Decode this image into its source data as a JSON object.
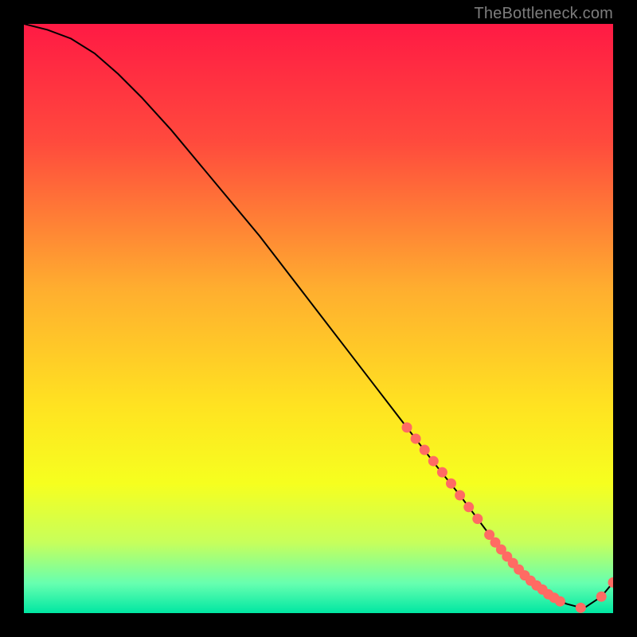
{
  "attribution": "TheBottleneck.com",
  "chart_data": {
    "type": "line",
    "title": "",
    "xlabel": "",
    "ylabel": "",
    "xlim": [
      0,
      100
    ],
    "ylim": [
      0,
      100
    ],
    "gradient_stops": [
      {
        "offset": 0,
        "color": "#ff1a44"
      },
      {
        "offset": 20,
        "color": "#ff4a3d"
      },
      {
        "offset": 45,
        "color": "#ffae2f"
      },
      {
        "offset": 65,
        "color": "#ffe321"
      },
      {
        "offset": 78,
        "color": "#f6ff1f"
      },
      {
        "offset": 88,
        "color": "#c7ff5b"
      },
      {
        "offset": 95,
        "color": "#66ffb0"
      },
      {
        "offset": 100,
        "color": "#00e7a2"
      }
    ],
    "series": [
      {
        "name": "bottleneck-curve",
        "type": "line",
        "color": "#000000",
        "x": [
          0,
          4,
          8,
          12,
          16,
          20,
          25,
          30,
          35,
          40,
          45,
          50,
          55,
          60,
          65,
          70,
          74,
          77,
          80,
          83,
          86,
          89,
          92,
          95,
          98,
          100
        ],
        "values": [
          100,
          99,
          97.5,
          95,
          91.5,
          87.5,
          82,
          76,
          70,
          64,
          57.5,
          51,
          44.5,
          38,
          31.5,
          25,
          20,
          16,
          12,
          8.5,
          5.5,
          3.2,
          1.6,
          0.8,
          2.8,
          5.2
        ]
      },
      {
        "name": "highlight-points",
        "type": "scatter",
        "color": "#ff6b63",
        "x": [
          65,
          66.5,
          68,
          69.5,
          71,
          72.5,
          74,
          75.5,
          77,
          79,
          80,
          81,
          82,
          83,
          84,
          85,
          86,
          87,
          88,
          89,
          90,
          91,
          94.5,
          98,
          100
        ],
        "values": [
          31.5,
          29.6,
          27.7,
          25.8,
          23.9,
          22,
          20,
          18,
          16,
          13.3,
          12,
          10.8,
          9.6,
          8.5,
          7.4,
          6.4,
          5.5,
          4.7,
          4,
          3.2,
          2.6,
          2,
          0.9,
          2.8,
          5.2
        ]
      }
    ]
  }
}
